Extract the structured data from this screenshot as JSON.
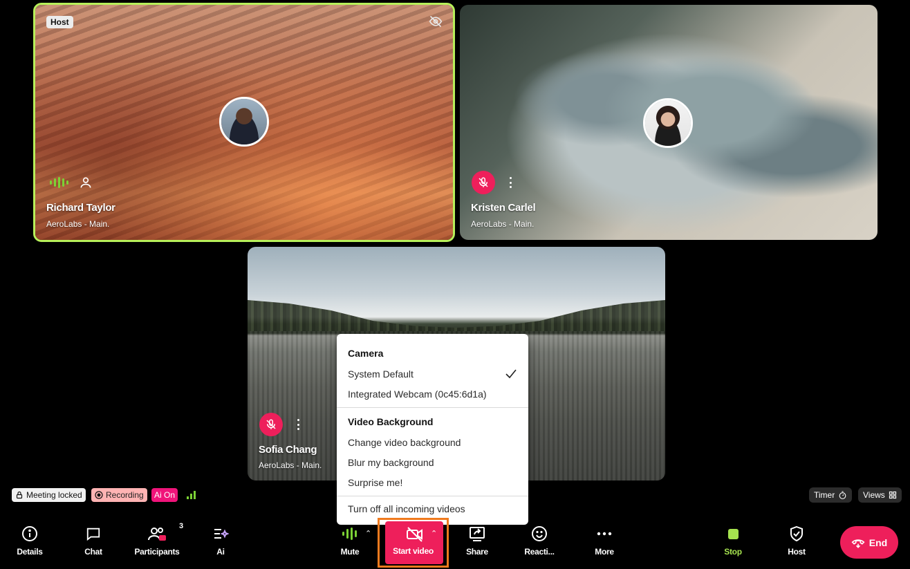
{
  "tiles": {
    "richard": {
      "host_label": "Host",
      "name": "Richard Taylor",
      "org": "AeroLabs - Main."
    },
    "kristen": {
      "name": "Kristen Carlel",
      "org": "AeroLabs - Main."
    },
    "sofia": {
      "name": "Sofia Chang",
      "org": "AeroLabs - Main."
    }
  },
  "video_menu": {
    "camera_header": "Camera",
    "camera_options": [
      "System Default",
      "Integrated Webcam (0c45:6d1a)"
    ],
    "selected_camera": "System Default",
    "background_header": "Video Background",
    "background_options": [
      "Change video background",
      "Blur my background",
      "Surprise me!"
    ],
    "turn_off_incoming": "Turn off all incoming videos"
  },
  "status": {
    "locked": "Meeting locked",
    "recording": "Recording",
    "ai": "Ai On",
    "timer": "Timer",
    "views": "Views"
  },
  "toolbar": {
    "details": "Details",
    "chat": "Chat",
    "participants": "Participants",
    "participants_count": "3",
    "ai": "Ai",
    "mute": "Mute",
    "start_video": "Start video",
    "share": "Share",
    "reactions": "Reacti...",
    "more": "More",
    "stop": "Stop",
    "host": "Host",
    "end": "End"
  },
  "colors": {
    "accent_pink": "#ee1f5b",
    "active_green": "#b7f05a",
    "highlight_orange": "#f07a1e"
  }
}
